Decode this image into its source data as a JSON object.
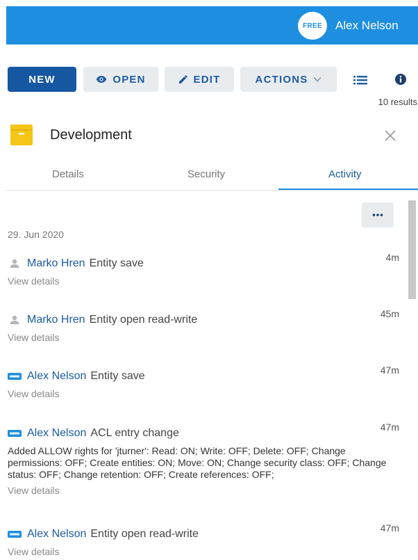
{
  "header": {
    "badge_text": "FREE",
    "user_name": "Alex Nelson",
    "background_color": "#1e8fe0"
  },
  "toolbar": {
    "new_label": "NEW",
    "open_label": "OPEN",
    "edit_label": "EDIT",
    "actions_label": "ACTIONS",
    "results_text": "10 results"
  },
  "entity": {
    "title": "Development",
    "icon": "folder-icon"
  },
  "tabs": [
    {
      "label": "Details",
      "active": false
    },
    {
      "label": "Security",
      "active": false
    },
    {
      "label": "Activity",
      "active": true
    }
  ],
  "activity": {
    "date": "29. Jun 2020",
    "view_details_label": "View details",
    "entries": [
      {
        "user": "Marko Hren",
        "user_icon": "person-icon",
        "action": "Entity save",
        "time": "4m",
        "details": ""
      },
      {
        "user": "Marko Hren",
        "user_icon": "person-icon",
        "action": "Entity open read-write",
        "time": "45m",
        "details": ""
      },
      {
        "user": "Alex Nelson",
        "user_icon": "free-badge-icon",
        "action": "Entity save",
        "time": "47m",
        "details": ""
      },
      {
        "user": "Alex Nelson",
        "user_icon": "free-badge-icon",
        "action": "ACL entry change",
        "time": "47m",
        "details": "Added ALLOW rights for 'jturner': Read: ON; Write: OFF; Delete: OFF; Change permissions: OFF; Create entities: ON; Move: ON; Change security class: OFF; Change status: OFF; Change retention: OFF; Create references: OFF;"
      },
      {
        "user": "Alex Nelson",
        "user_icon": "free-badge-icon",
        "action": "Entity open read-write",
        "time": "47m",
        "details": ""
      }
    ]
  },
  "colors": {
    "primary": "#1557a0",
    "accent": "#1e8fe0",
    "folder": "#f5c518"
  }
}
